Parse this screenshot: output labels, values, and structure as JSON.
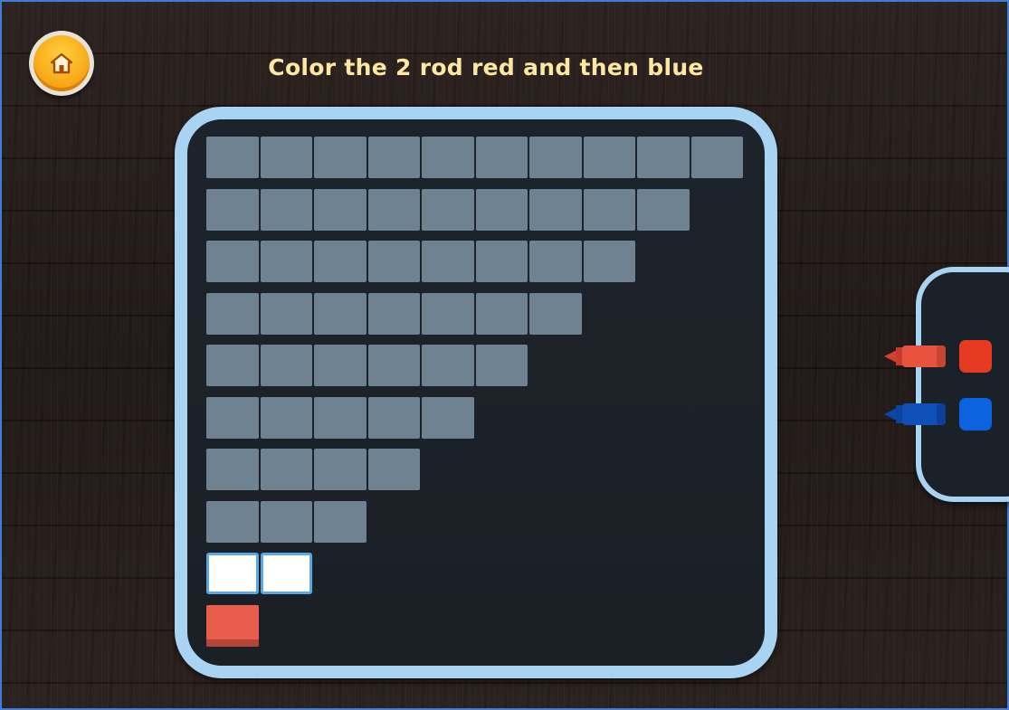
{
  "header": {
    "title": "Color the 2 rod red and then blue",
    "home_icon": "home-icon"
  },
  "board": {
    "rods": [
      {
        "length": 10,
        "state": "empty"
      },
      {
        "length": 9,
        "state": "empty"
      },
      {
        "length": 8,
        "state": "empty"
      },
      {
        "length": 7,
        "state": "empty"
      },
      {
        "length": 6,
        "state": "empty"
      },
      {
        "length": 5,
        "state": "empty"
      },
      {
        "length": 4,
        "state": "empty"
      },
      {
        "length": 3,
        "state": "empty"
      },
      {
        "length": 2,
        "state": "selected"
      },
      {
        "length": 1,
        "state": "red"
      }
    ]
  },
  "palette": {
    "colors": [
      {
        "name": "red",
        "hex": "#e53b22",
        "crayon_hex": "#e8533f"
      },
      {
        "name": "blue",
        "hex": "#0d62e0",
        "crayon_hex": "#0e4fb8"
      }
    ]
  },
  "colors": {
    "cell_empty": "#6f8291",
    "cell_selected_border": "#5ba7e6",
    "board_frame": "#a8d3f2",
    "title_text": "#fde8a2"
  }
}
